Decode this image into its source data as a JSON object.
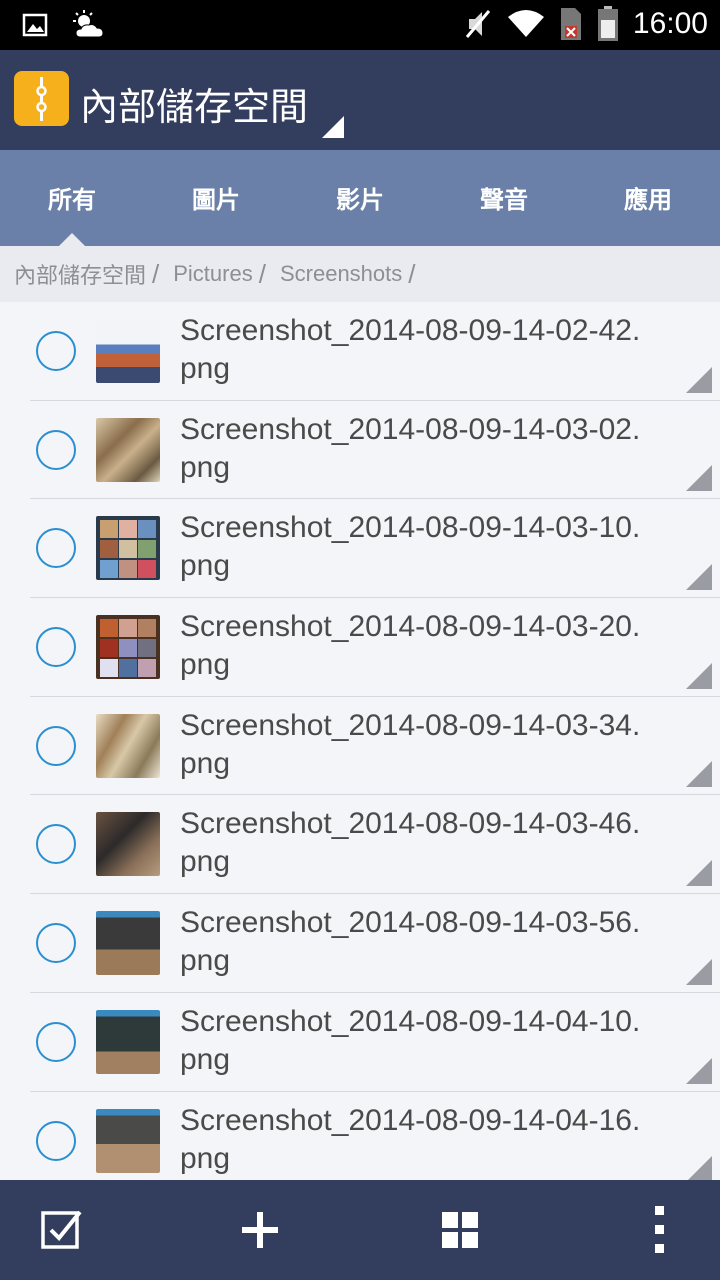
{
  "status_bar": {
    "time": "16:00",
    "icons": [
      "image-notification-icon",
      "weather-partly-cloudy-icon",
      "mute-icon",
      "wifi-icon",
      "no-sim-icon",
      "battery-icon"
    ]
  },
  "app_bar": {
    "title": "內部儲存空間",
    "logo_icon": "file-manager-zipper-icon",
    "logo_color": "#f5b01c",
    "background": "#333d5e"
  },
  "tabs": [
    {
      "label": "所有",
      "active": true
    },
    {
      "label": "圖片",
      "active": false
    },
    {
      "label": "影片",
      "active": false
    },
    {
      "label": "聲音",
      "active": false
    },
    {
      "label": "應用",
      "active": false
    }
  ],
  "breadcrumb": [
    "內部儲存空間",
    "Pictures",
    "Screenshots"
  ],
  "files": [
    {
      "name": "Screenshot_2014-08-09-14-02-42.png",
      "thumb": "city"
    },
    {
      "name": "Screenshot_2014-08-09-14-03-02.png",
      "thumb": "food"
    },
    {
      "name": "Screenshot_2014-08-09-14-03-10.png",
      "thumb": "grid"
    },
    {
      "name": "Screenshot_2014-08-09-14-03-20.png",
      "thumb": "grid"
    },
    {
      "name": "Screenshot_2014-08-09-14-03-34.png",
      "thumb": "food"
    },
    {
      "name": "Screenshot_2014-08-09-14-03-46.png",
      "thumb": "dark"
    },
    {
      "name": "Screenshot_2014-08-09-14-03-56.png",
      "thumb": "dark"
    },
    {
      "name": "Screenshot_2014-08-09-14-04-10.png",
      "thumb": "dark"
    },
    {
      "name": "Screenshot_2014-08-09-14-04-16.png",
      "thumb": "dark"
    }
  ],
  "bottom_bar": {
    "actions": [
      "select-icon",
      "add-icon",
      "grid-view-icon",
      "more-options-icon"
    ]
  },
  "colors": {
    "accent": "#2a8fd0",
    "tab_bar": "#6b80a8",
    "list_background": "#f4f5f8"
  }
}
